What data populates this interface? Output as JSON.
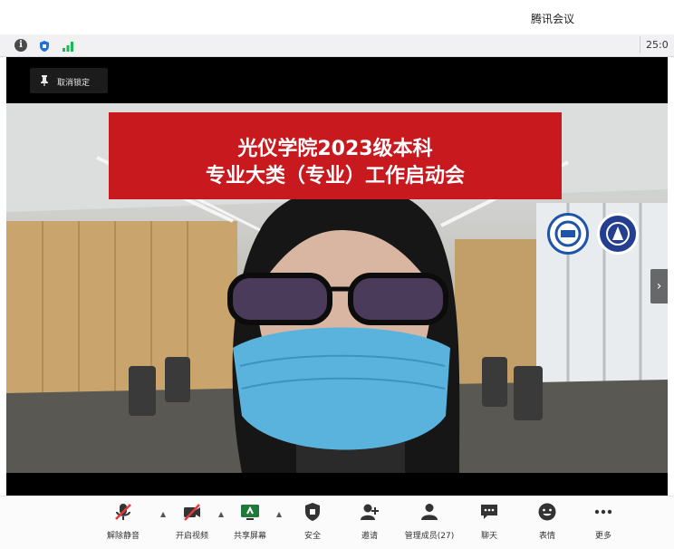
{
  "window": {
    "title": "腾讯会议"
  },
  "infobar": {
    "timer": "25:0"
  },
  "stage": {
    "unpin_label": "取消锁定",
    "banner": {
      "line1": "光仪学院2023级本科",
      "line2": "专业大类（专业）工作启动会"
    }
  },
  "toolbar": {
    "items": [
      {
        "label": "解除静音",
        "icon": "mic-muted-icon"
      },
      {
        "label": "开启视频",
        "icon": "video-off-icon"
      },
      {
        "label": "共享屏幕",
        "icon": "share-screen-icon"
      },
      {
        "label": "安全",
        "icon": "shield-icon"
      },
      {
        "label": "邀请",
        "icon": "invite-icon"
      },
      {
        "label": "管理成员(27)",
        "icon": "members-icon"
      },
      {
        "label": "聊天",
        "icon": "chat-icon"
      },
      {
        "label": "表情",
        "icon": "emoji-icon"
      },
      {
        "label": "更多",
        "icon": "more-icon"
      }
    ]
  },
  "colors": {
    "banner_red": "#c8191f",
    "accent_green": "#19b955",
    "accent_blue": "#1e6fe0"
  }
}
